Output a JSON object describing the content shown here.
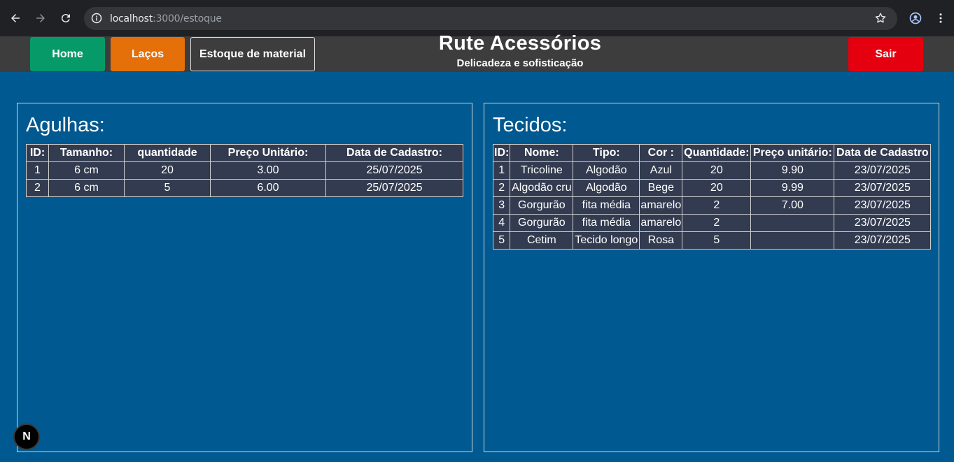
{
  "browser": {
    "url_host": "localhost",
    "url_path": ":3000/estoque"
  },
  "header": {
    "home_label": "Home",
    "lacos_label": "Laços",
    "estoque_label": "Estoque de material",
    "title": "Rute Acessórios",
    "subtitle": "Delicadeza e sofisticação",
    "sair_label": "Sair"
  },
  "agulhas": {
    "title": "Agulhas:",
    "headers": [
      "ID:",
      "Tamanho:",
      "quantidade",
      "Preço Unitário:",
      "Data de Cadastro:"
    ],
    "rows": [
      [
        "1",
        "6 cm",
        "20",
        "3.00",
        "25/07/2025"
      ],
      [
        "2",
        "6 cm",
        "5",
        "6.00",
        "25/07/2025"
      ]
    ]
  },
  "tecidos": {
    "title": "Tecidos:",
    "headers": [
      "ID:",
      "Nome:",
      "Tipo:",
      "Cor :",
      "Quantidade:",
      "Preço unitário:",
      "Data de Cadastro"
    ],
    "rows": [
      [
        "1",
        "Tricoline",
        "Algodão",
        "Azul",
        "20",
        "9.90",
        "23/07/2025"
      ],
      [
        "2",
        "Algodão cru",
        "Algodão",
        "Bege",
        "20",
        "9.99",
        "23/07/2025"
      ],
      [
        "3",
        "Gorgurão",
        "fita média",
        "amarelo",
        "2",
        "7.00",
        "23/07/2025"
      ],
      [
        "4",
        "Gorgurão",
        "fita média",
        "amarelo",
        "2",
        "",
        "23/07/2025"
      ],
      [
        "5",
        "Cetim",
        "Tecido longo",
        "Rosa",
        "5",
        "",
        "23/07/2025"
      ]
    ]
  },
  "next_badge": "N",
  "colors": {
    "background": "#005990",
    "header_bg": "#3d3d3d",
    "home": "#079a69",
    "lacos": "#e56f08",
    "sair": "#e4000f",
    "table_bg": "#323b4f"
  }
}
